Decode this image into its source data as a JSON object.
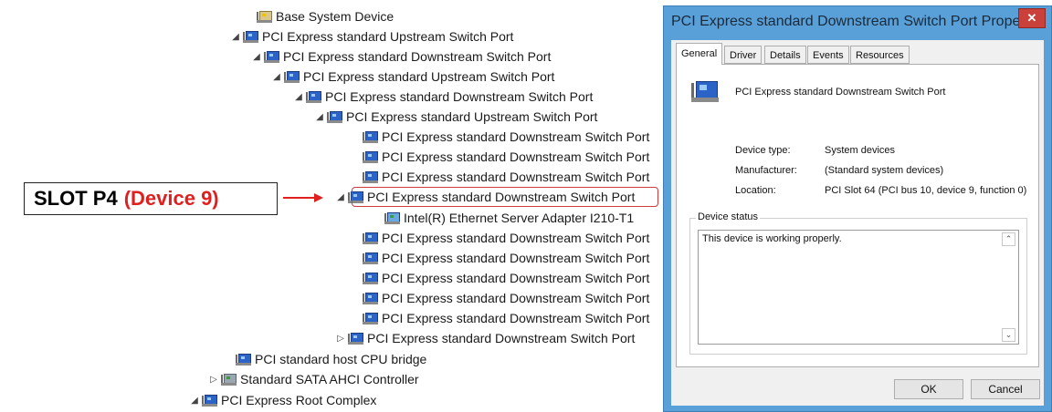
{
  "tree": [
    {
      "label": "Base System Device",
      "icon": "warning-device-icon",
      "expander": "none"
    },
    {
      "label": "PCI Express standard Upstream Switch Port",
      "icon": "pci-device-icon",
      "expander": "expanded"
    },
    {
      "label": "PCI Express standard Downstream Switch Port",
      "icon": "pci-device-icon",
      "expander": "expanded"
    },
    {
      "label": "PCI Express standard Upstream Switch Port",
      "icon": "pci-device-icon",
      "expander": "expanded"
    },
    {
      "label": "PCI Express standard Downstream Switch Port",
      "icon": "pci-device-icon",
      "expander": "expanded"
    },
    {
      "label": "PCI Express standard Upstream Switch Port",
      "icon": "pci-device-icon",
      "expander": "expanded"
    },
    {
      "label": "PCI Express standard Downstream Switch Port",
      "icon": "pci-device-icon",
      "expander": "none"
    },
    {
      "label": "PCI Express standard Downstream Switch Port",
      "icon": "pci-device-icon",
      "expander": "none"
    },
    {
      "label": "PCI Express standard Downstream Switch Port",
      "icon": "pci-device-icon",
      "expander": "none"
    },
    {
      "label": "PCI Express standard Downstream Switch Port",
      "icon": "pci-device-icon",
      "expander": "expanded"
    },
    {
      "label": "Intel(R) Ethernet Server Adapter I210-T1",
      "icon": "network-adapter-icon",
      "expander": "none"
    },
    {
      "label": "PCI Express standard Downstream Switch Port",
      "icon": "pci-device-icon",
      "expander": "none"
    },
    {
      "label": "PCI Express standard Downstream Switch Port",
      "icon": "pci-device-icon",
      "expander": "none"
    },
    {
      "label": "PCI Express standard Downstream Switch Port",
      "icon": "pci-device-icon",
      "expander": "none"
    },
    {
      "label": "PCI Express standard Downstream Switch Port",
      "icon": "pci-device-icon",
      "expander": "none"
    },
    {
      "label": "PCI Express standard Downstream Switch Port",
      "icon": "pci-device-icon",
      "expander": "none"
    },
    {
      "label": "PCI Express standard Downstream Switch Port",
      "icon": "pci-device-icon",
      "expander": "collapsed"
    },
    {
      "label": "PCI standard host CPU bridge",
      "icon": "pci-device-icon",
      "expander": "none"
    },
    {
      "label": "Standard SATA AHCI Controller",
      "icon": "storage-controller-icon",
      "expander": "collapsed"
    },
    {
      "label": "PCI Express Root Complex",
      "icon": "pci-device-icon",
      "expander": "expanded"
    }
  ],
  "annotation": {
    "slot_text": "SLOT P4",
    "device_text": "(Device 9)",
    "highlight_color": "#d33b3b",
    "device_text_color": "#e01f1f"
  },
  "dialog": {
    "title": "PCI Express standard Downstream Switch Port Propert...",
    "close_glyph": "✕",
    "tabs": [
      "General",
      "Driver",
      "Details",
      "Events",
      "Resources"
    ],
    "active_tab": "General",
    "device_name": "PCI Express standard Downstream Switch Port",
    "properties": [
      {
        "label": "Device type:",
        "value": "System devices"
      },
      {
        "label": "Manufacturer:",
        "value": "(Standard system devices)"
      },
      {
        "label": "Location:",
        "value": "PCI Slot 64 (PCI bus 10, device 9, function 0)"
      }
    ],
    "status_legend": "Device status",
    "status_text": "This device is working properly.",
    "ok_label": "OK",
    "cancel_label": "Cancel",
    "title_bar_color": "#5aa0d8"
  }
}
